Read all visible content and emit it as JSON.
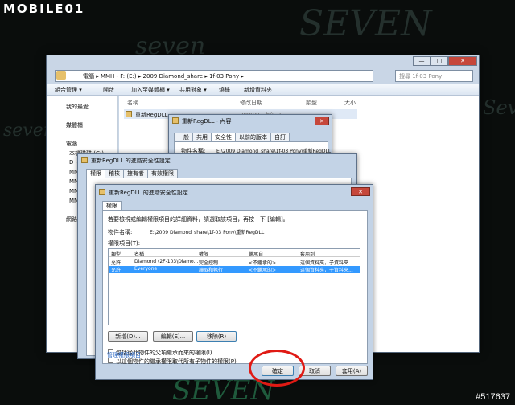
{
  "logo": "MOBILE01",
  "watermark": "#517637",
  "background": {
    "texts": [
      "SEVEN",
      "seven",
      "Seven",
      "seven",
      "SEVEN"
    ]
  },
  "explorer": {
    "address": "電腦 ▸ MMH - F: (E:) ▸ 2009 Diamond_share ▸ 1f-03 Pony ▸",
    "search_placeholder": "搜尋 1f-03 Pony",
    "toolbar": [
      "組合管理 ▾",
      "開啟",
      "加入至媒體櫃 ▾",
      "共用對象 ▾",
      "燒錄",
      "新增資料夾"
    ],
    "nav": [
      "我的最愛",
      "媒體櫃",
      "電腦",
      "本機磁碟 (C:)",
      "D -",
      "MM",
      "MM",
      "MM",
      "MM",
      "網路"
    ],
    "columns": [
      "名稱",
      "修改日期",
      "類型",
      "大小"
    ],
    "file": {
      "name": "重新RegDLL",
      "date": "2009/0_ 上午 0_"
    }
  },
  "props_dialog": {
    "title": "重新RegDLL - 內容",
    "tabs": [
      "一般",
      "共用",
      "安全性",
      "以前的版本",
      "自訂"
    ],
    "object_label": "物件名稱:",
    "object_value": "E:\\2009 Diamond_share\\1f-03 Pony\\重新RegDLL"
  },
  "adv_dialog": {
    "title": "重新RegDLL 的進階安全性設定",
    "tabs": [
      "權限",
      "稽核",
      "擁有者",
      "有效權限"
    ]
  },
  "perm_dialog": {
    "title": "重新RegDLL 的進階安全性設定",
    "tab": "權限",
    "instruction": "若要檢視或編輯權限項目的詳細資料，請選取該項目，再按一下 [編輯]。",
    "object_label": "物件名稱:",
    "object_value": "E:\\2009 Diamond_share\\1f-03 Pony\\重新RegDLL",
    "entries_label": "權限項目(T):",
    "columns": [
      "類型",
      "名稱",
      "權限",
      "繼承自",
      "套用到"
    ],
    "rows": [
      {
        "type": "允許",
        "name": "Diamond (2F-103\\Diamo...",
        "perm": "完全控制",
        "inherit": "<不繼承的>",
        "apply": "這個資料夾，子資料夾..."
      },
      {
        "type": "允許",
        "name": "Everyone",
        "perm": "讀取和執行",
        "inherit": "<不繼承的>",
        "apply": "這個資料夾，子資料夾..."
      }
    ],
    "add_btn": "新增(D)...",
    "edit_btn": "編輯(E)...",
    "remove_btn": "移除(R)",
    "check1": "包括從此物件的父項繼承而來的權限(I)",
    "check2": "以這個物件的繼承權限取代所有子物件的權限(P)",
    "manage_link": "管理權限項目",
    "ok_btn": "確定",
    "cancel_btn": "取消",
    "apply_btn": "套用(A)"
  }
}
